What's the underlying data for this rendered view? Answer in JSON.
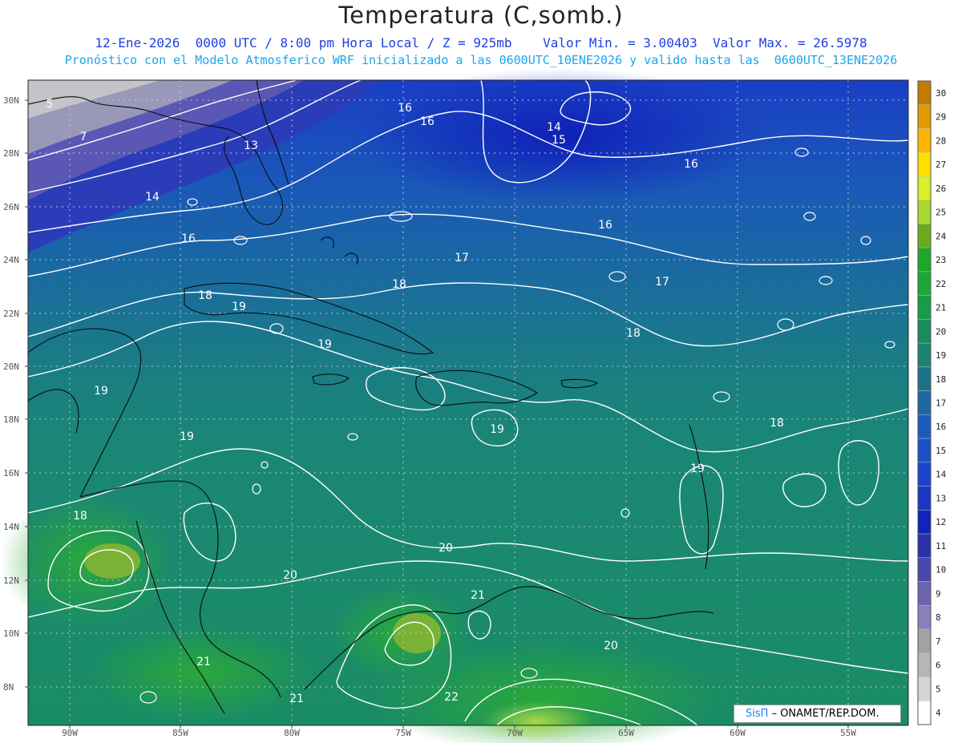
{
  "header": {
    "title": "Temperatura (C,somb.)",
    "line1": "12-Ene-2026  0000 UTC / 8:00 pm Hora Local / Z = 925mb    Valor Min. = 3.00403  Valor Max. = 26.5978",
    "line2": "Pronóstico con el Modelo Atmosferico WRF inicializado a las 0600UTC_10ENE2026 y valido hasta las  0600UTC_13ENE2026"
  },
  "map": {
    "lat_labels": [
      "30N",
      "28N",
      "26N",
      "24N",
      "22N",
      "20N",
      "18N",
      "16N",
      "14N",
      "12N",
      "10N",
      "8N"
    ],
    "lon_labels": [
      "90W",
      "85W",
      "80W",
      "75W",
      "70W",
      "65W",
      "60W",
      "55W"
    ],
    "contour_labels": [
      {
        "text": "5"
      },
      {
        "text": "7"
      },
      {
        "text": "13"
      },
      {
        "text": "14"
      },
      {
        "text": "16"
      },
      {
        "text": "16"
      },
      {
        "text": "16"
      },
      {
        "text": "14"
      },
      {
        "text": "15"
      },
      {
        "text": "16"
      },
      {
        "text": "16"
      },
      {
        "text": "17"
      },
      {
        "text": "17"
      },
      {
        "text": "18"
      },
      {
        "text": "18"
      },
      {
        "text": "19"
      },
      {
        "text": "19"
      },
      {
        "text": "18"
      },
      {
        "text": "19"
      },
      {
        "text": "19"
      },
      {
        "text": "19"
      },
      {
        "text": "18"
      },
      {
        "text": "19"
      },
      {
        "text": "18"
      },
      {
        "text": "20"
      },
      {
        "text": "20"
      },
      {
        "text": "21"
      },
      {
        "text": "20"
      },
      {
        "text": "21"
      },
      {
        "text": "21"
      },
      {
        "text": "22"
      }
    ],
    "ocean_color": "#1f8a78",
    "cold_color": "#1636c8"
  },
  "legend": {
    "values": [
      "30",
      "29",
      "28",
      "27",
      "26",
      "25",
      "24",
      "23",
      "22",
      "21",
      "20",
      "19",
      "18",
      "17",
      "16",
      "15",
      "14",
      "13",
      "12",
      "11",
      "10",
      "9",
      "8",
      "7",
      "6",
      "5",
      "4"
    ],
    "colors": [
      "#c07d00",
      "#e09a00",
      "#ffb400",
      "#ffe000",
      "#d9f02a",
      "#a8d830",
      "#6aaa1e",
      "#1ea82a",
      "#1ca838",
      "#1b9a4a",
      "#1a8c5e",
      "#1a8372",
      "#1a7488",
      "#1a68a6",
      "#1a5cba",
      "#1a50c6",
      "#1a44cc",
      "#1a36c6",
      "#0f24bc",
      "#2a30a8",
      "#4a48ac",
      "#6c64b0",
      "#8a7ebc",
      "#a2a2a2",
      "#b6b6b6",
      "#d4d4d4",
      "#ffffff"
    ]
  },
  "credit": {
    "brand": "SisΠ",
    "text": "– ONAMET/REP.DOM."
  }
}
